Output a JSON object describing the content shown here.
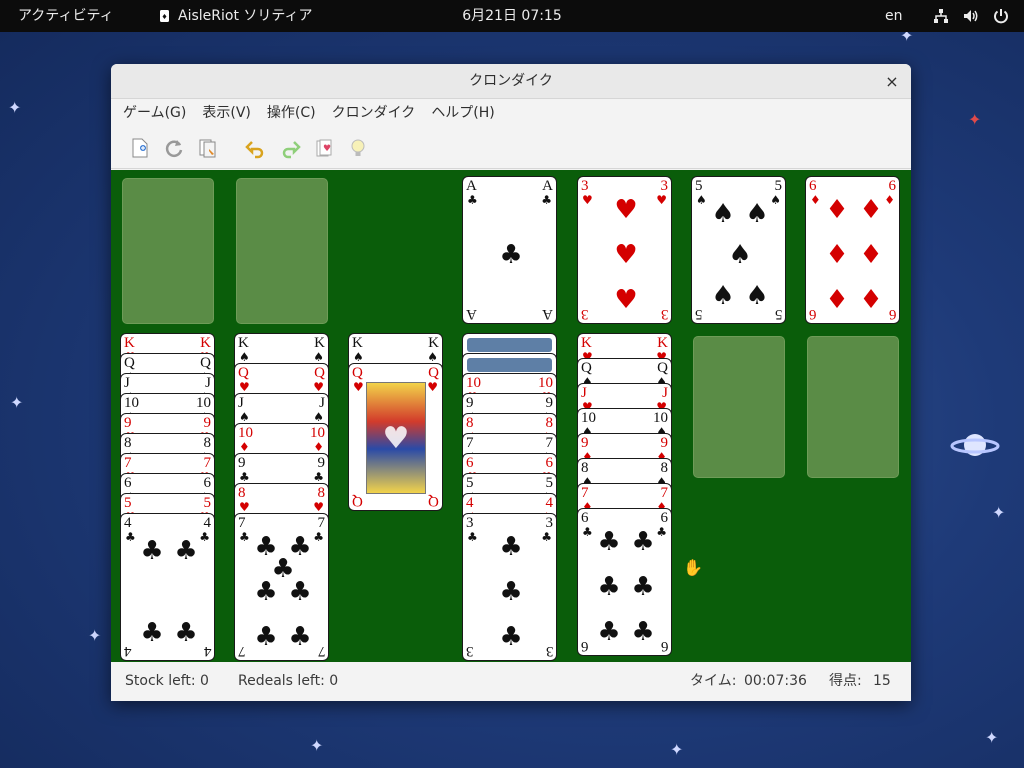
{
  "topbar": {
    "activities": "アクティビティ",
    "app_name": "AisleRiot ソリティア",
    "clock": "6月21日  07:15",
    "lang": "en",
    "icons": [
      "network-icon",
      "volume-icon",
      "power-icon"
    ]
  },
  "window": {
    "title": "クロンダイク",
    "close": "×",
    "menu": [
      "ゲーム(G)",
      "表示(V)",
      "操作(C)",
      "クロンダイク",
      "ヘルプ(H)"
    ],
    "toolbar": [
      "new-game-icon",
      "restart-icon",
      "select-game-icon",
      "undo-icon",
      "redo-icon",
      "deal-icon",
      "hint-icon"
    ]
  },
  "game": {
    "foundations": [
      {
        "rank": "A",
        "suit": "♣",
        "color": "blk"
      },
      {
        "rank": "3",
        "suit": "♥",
        "color": "red"
      },
      {
        "rank": "5",
        "suit": "♠",
        "color": "blk"
      },
      {
        "rank": "6",
        "suit": "♦",
        "color": "red"
      }
    ],
    "tableau": [
      [
        {
          "rank": "K",
          "suit": "♥",
          "color": "red"
        },
        {
          "rank": "Q",
          "suit": "♠",
          "color": "blk"
        },
        {
          "rank": "J",
          "suit": "♠",
          "color": "blk"
        },
        {
          "rank": "10",
          "suit": "♠",
          "color": "blk"
        },
        {
          "rank": "9",
          "suit": "♥",
          "color": "red"
        },
        {
          "rank": "8",
          "suit": "♠",
          "color": "blk"
        },
        {
          "rank": "7",
          "suit": "♥",
          "color": "red"
        },
        {
          "rank": "6",
          "suit": "♠",
          "color": "blk"
        },
        {
          "rank": "5",
          "suit": "♥",
          "color": "red"
        },
        {
          "rank": "4",
          "suit": "♣",
          "color": "blk"
        }
      ],
      [
        {
          "rank": "K",
          "suit": "♠",
          "color": "blk"
        },
        {
          "rank": "Q",
          "suit": "♥",
          "color": "red"
        },
        {
          "rank": "J",
          "suit": "♠",
          "color": "blk"
        },
        {
          "rank": "10",
          "suit": "♦",
          "color": "red"
        },
        {
          "rank": "9",
          "suit": "♣",
          "color": "blk"
        },
        {
          "rank": "8",
          "suit": "♥",
          "color": "red"
        },
        {
          "rank": "7",
          "suit": "♣",
          "color": "blk"
        }
      ],
      [
        {
          "rank": "K",
          "suit": "♠",
          "color": "blk"
        },
        {
          "rank": "Q",
          "suit": "♥",
          "color": "red"
        }
      ],
      [
        {
          "rank": "",
          "suit": "",
          "color": "back"
        },
        {
          "rank": "",
          "suit": "",
          "color": "back"
        },
        {
          "rank": "10",
          "suit": "♥",
          "color": "red"
        },
        {
          "rank": "9",
          "suit": "♠",
          "color": "blk"
        },
        {
          "rank": "8",
          "suit": "♦",
          "color": "red"
        },
        {
          "rank": "7",
          "suit": "♠",
          "color": "blk"
        },
        {
          "rank": "6",
          "suit": "♥",
          "color": "red"
        },
        {
          "rank": "5",
          "suit": "♠",
          "color": "blk"
        },
        {
          "rank": "4",
          "suit": "♦",
          "color": "red"
        },
        {
          "rank": "3",
          "suit": "♣",
          "color": "blk"
        }
      ],
      [
        {
          "rank": "K",
          "suit": "♥",
          "color": "red"
        },
        {
          "rank": "Q",
          "suit": "♠",
          "color": "blk"
        },
        {
          "rank": "J",
          "suit": "♥",
          "color": "red"
        },
        {
          "rank": "10",
          "suit": "♠",
          "color": "blk"
        },
        {
          "rank": "9",
          "suit": "♦",
          "color": "red"
        },
        {
          "rank": "8",
          "suit": "♠",
          "color": "blk"
        },
        {
          "rank": "7",
          "suit": "♦",
          "color": "red"
        },
        {
          "rank": "6",
          "suit": "♣",
          "color": "blk"
        }
      ],
      [],
      []
    ]
  },
  "status": {
    "stock": "Stock left: 0",
    "redeals": "Redeals left: 0",
    "time_label": "タイム:",
    "time_value": "00:07:36",
    "score_label": "得点:",
    "score_value": "15"
  },
  "colors": {
    "felt": "#0a5d0a",
    "slot": "#5a8c46",
    "red_suit": "#d40000",
    "black_suit": "#111111"
  }
}
